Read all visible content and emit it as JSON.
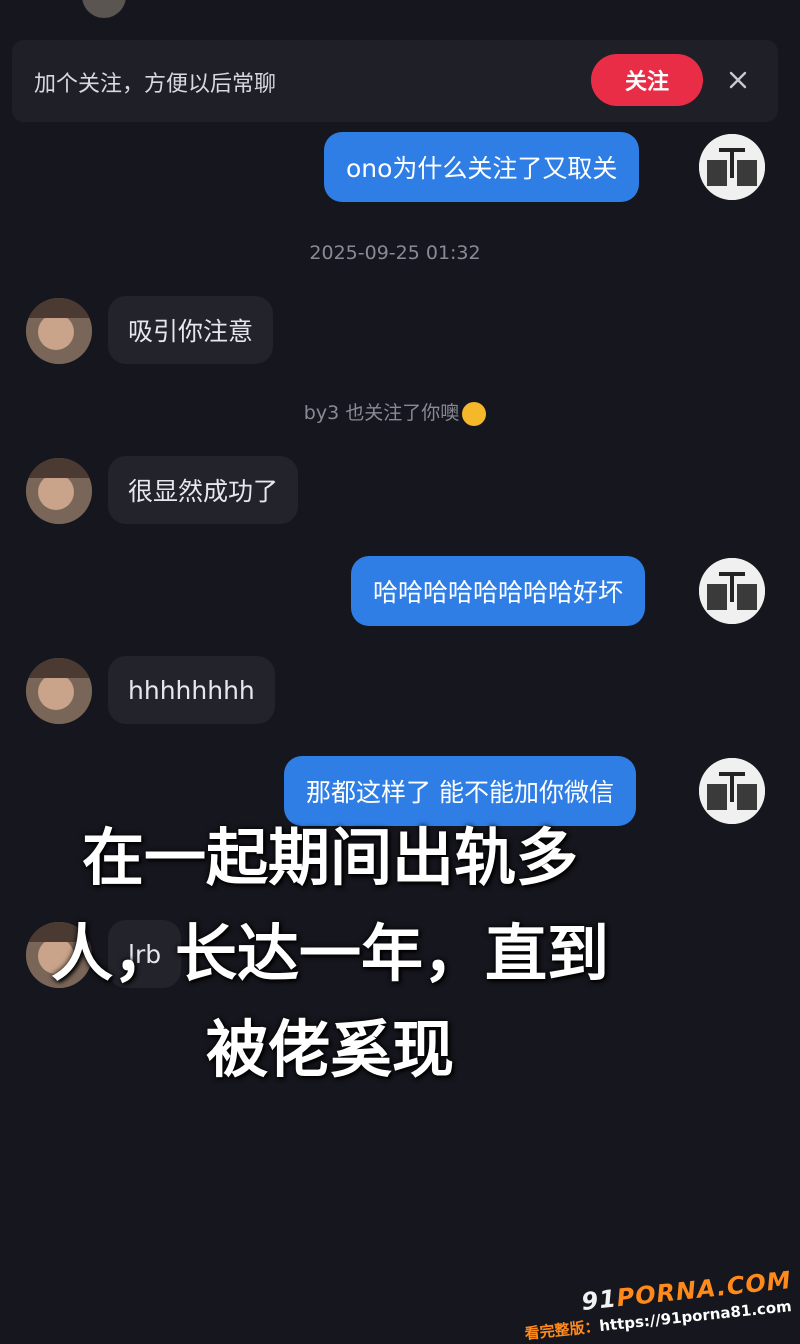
{
  "follow_banner": {
    "text": "加个关注，方便以后常聊",
    "button_label": "关注"
  },
  "messages": [
    {
      "side": "sent",
      "text": "ono为什么关注了又取关"
    },
    {
      "side": "recv",
      "text": "吸引你注意"
    },
    {
      "side": "recv",
      "text": "很显然成功了"
    },
    {
      "side": "sent",
      "text": "哈哈哈哈哈哈哈哈好坏"
    },
    {
      "side": "recv",
      "text": "hhhhhhhh"
    },
    {
      "side": "sent",
      "text": "那都这样了 能不能加你微信"
    },
    {
      "side": "recv",
      "text": "lrb"
    }
  ],
  "timestamp": "2025-09-25 01:32",
  "system_message": "by3 也关注了你噢",
  "overlay_caption": {
    "line1": "在一起期间出轨多",
    "line2": "人，长达一年，直到",
    "line3": "被佬奚现"
  },
  "watermark": {
    "logo_prefix": "91",
    "logo_brand": "PORNA.COM",
    "sub_label": "看完整版：",
    "sub_url": "https://91porna81.com"
  },
  "colors": {
    "background": "#16161e",
    "sent_bubble": "#2f7ee6",
    "recv_bubble": "#23232c",
    "follow_button": "#ea2d47"
  }
}
